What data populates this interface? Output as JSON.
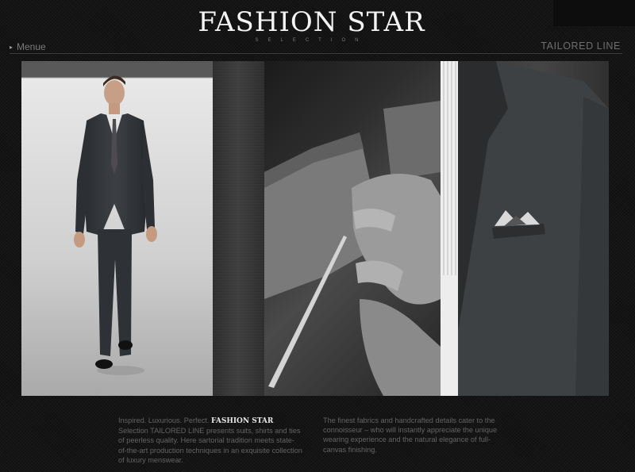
{
  "header": {
    "brand_title": "FASHION STAR",
    "brand_subtitle": "SELECTION",
    "menu_label": "Menue",
    "line_title": "TAILORED LINE"
  },
  "panels": [
    {
      "alt": "Model in dark grey suit"
    },
    {
      "alt": "Fabric texture"
    },
    {
      "alt": "Hands sewing lapel"
    },
    {
      "alt": "Suit jacket detail with pocket square"
    }
  ],
  "copy": {
    "left_intro": "Inspired. Luxurious. Perfect.",
    "left_brand": "FASHION STAR",
    "left_rest": "Selection TAILORED LINE presents suits, shirts and ties of peerless quality. Here sartorial tradition meets state-of-the-art production techniques in an exquisite collection of luxury menswear.",
    "right": "The finest fabrics and handcrafted details cater to the connoisseur – who will instantly appreciate the unique wearing experience and the natural elegance of full-canvas finishing."
  },
  "colors": {
    "background": "#141414",
    "brand_title": "#f4f4f4",
    "body_text": "#636363"
  }
}
